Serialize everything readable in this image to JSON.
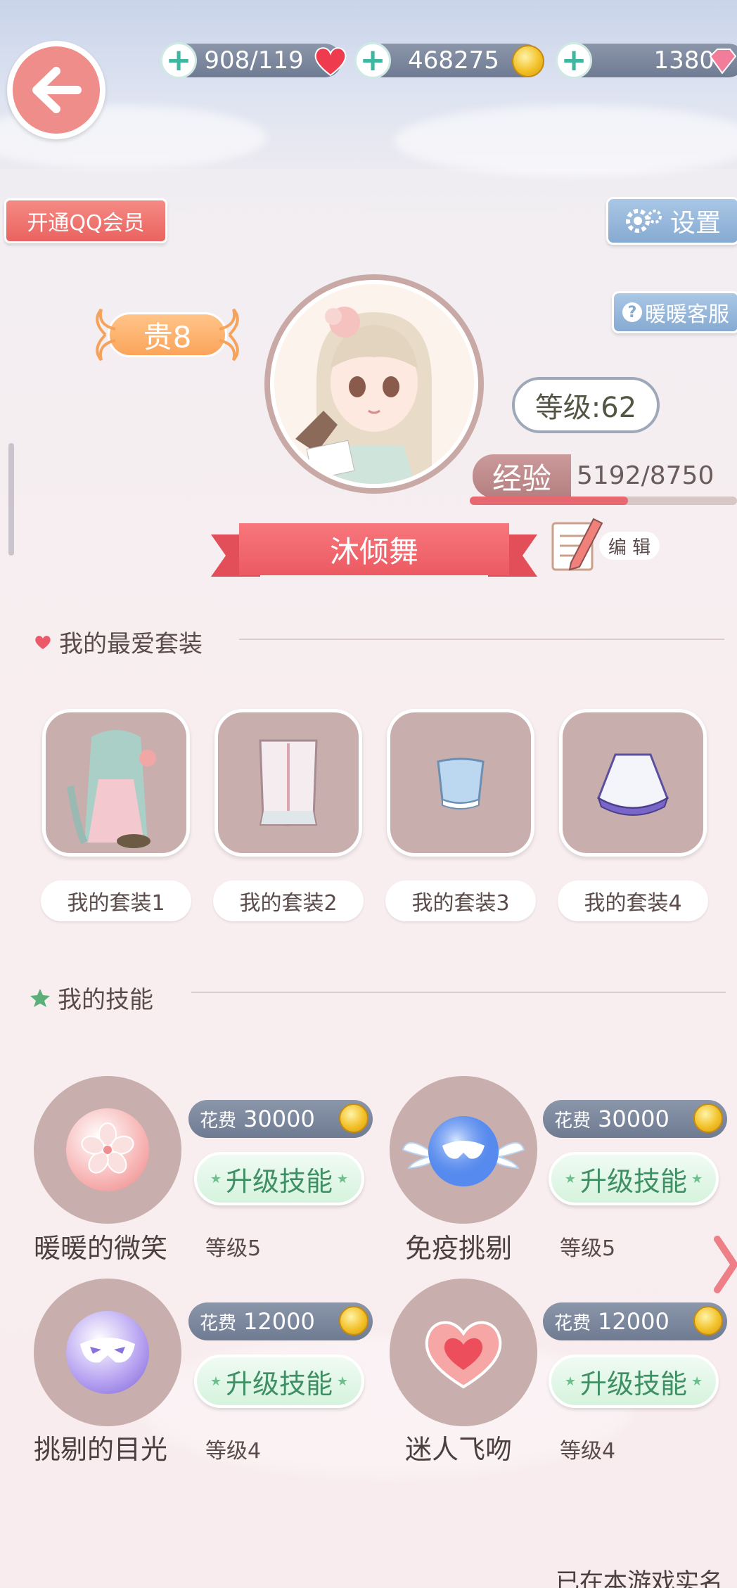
{
  "currency": {
    "stamina": "908/119",
    "gold": "468275",
    "diamond": "1380"
  },
  "buttons": {
    "qq_vip": "开通QQ会员",
    "settings": "设置",
    "support": "暖暖客服",
    "edit": "编 辑"
  },
  "profile": {
    "vip_level": "贵8",
    "level": "等级:62",
    "exp_label": "经验",
    "exp_value": "5192/8750",
    "exp_progress": 0.593,
    "name": "沐倾舞"
  },
  "favorites": {
    "title": "我的最爱套装",
    "items": [
      {
        "label": "我的套装1"
      },
      {
        "label": "我的套装2"
      },
      {
        "label": "我的套装3"
      },
      {
        "label": "我的套装4"
      }
    ]
  },
  "skills": {
    "title": "我的技能",
    "cost_label": "花费",
    "upgrade_label": "升级技能",
    "items": [
      {
        "name": "暖暖的微笑",
        "level": "等级5",
        "cost": "30000",
        "icon": "sakura-icon"
      },
      {
        "name": "免疫挑剔",
        "level": "等级5",
        "cost": "30000",
        "icon": "winged-mask-icon"
      },
      {
        "name": "挑剔的目光",
        "level": "等级4",
        "cost": "12000",
        "icon": "mask-icon"
      },
      {
        "name": "迷人飞吻",
        "level": "等级4",
        "cost": "12000",
        "icon": "heart-icon"
      }
    ]
  },
  "footer_text": "已在本游戏实名"
}
